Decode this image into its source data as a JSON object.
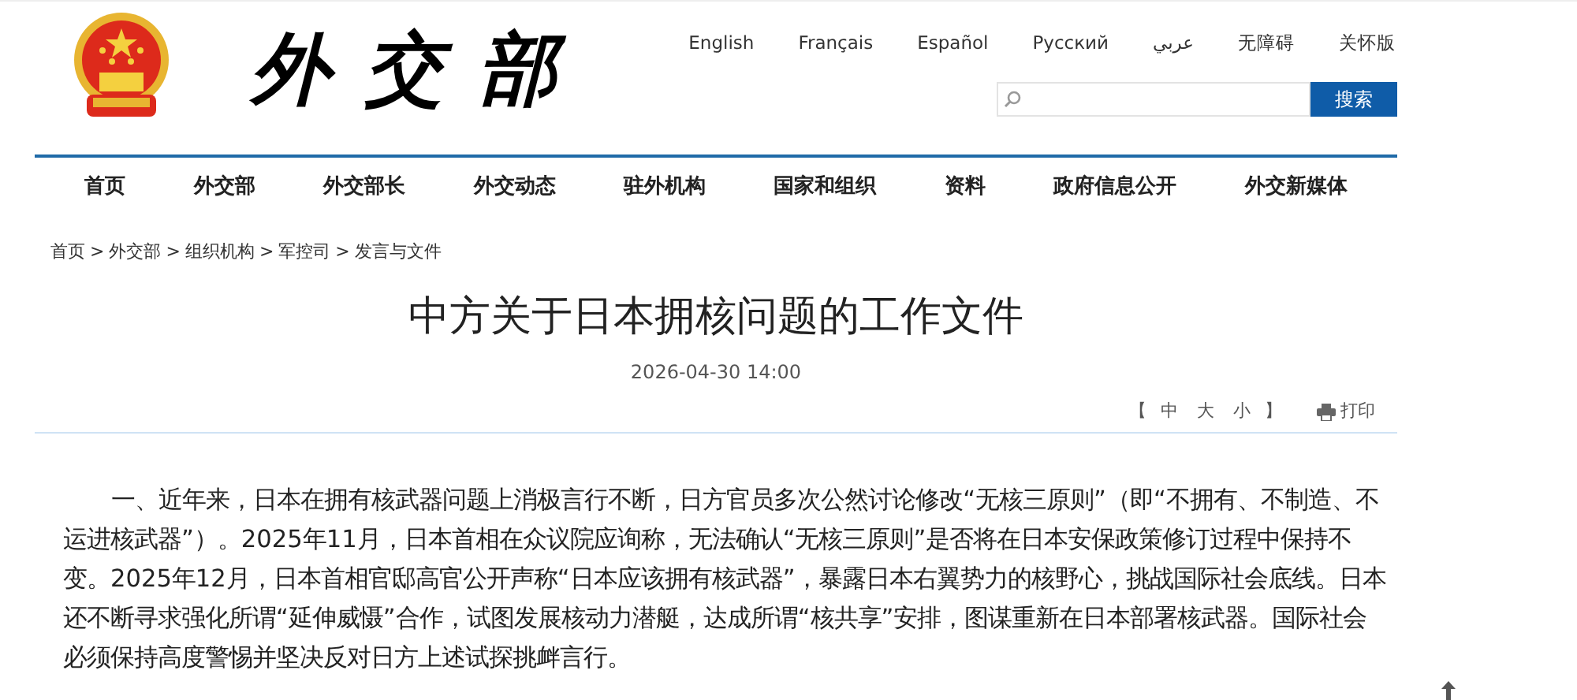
{
  "header": {
    "logo_text": "外交部",
    "languages": [
      "English",
      "Français",
      "Español",
      "Русский",
      "عربي",
      "无障碍",
      "关怀版"
    ],
    "search": {
      "button": "搜索"
    }
  },
  "nav": [
    {
      "label": "首页"
    },
    {
      "label": "外交部"
    },
    {
      "label": "外交部长"
    },
    {
      "label": "外交动态"
    },
    {
      "label": "驻外机构"
    },
    {
      "label": "国家和组织"
    },
    {
      "label": "资料"
    },
    {
      "label": "政府信息公开"
    },
    {
      "label": "外交新媒体"
    }
  ],
  "breadcrumb": [
    "首页",
    "外交部",
    "组织机构",
    "军控司",
    "发言与文件"
  ],
  "breadcrumb_separator": ">",
  "article": {
    "title": "中方关于日本拥核问题的工作文件",
    "date": "2026-04-30 14:00",
    "font_sizes": {
      "open": "【",
      "items": [
        "中",
        "大",
        "小"
      ],
      "close": "】"
    },
    "print": "打印",
    "paragraphs": [
      "一、近年来，日本在拥有核武器问题上消极言行不断，日方官员多次公然讨论修改“无核三原则”（即“不拥有、不制造、不运进核武器”）。2025年11月，日本首相在众议院应询称，无法确认“无核三原则”是否将在日本安保政策修订过程中保持不变。2025年12月，日本首相官邸高官公开声称“日本应该拥有核武器”，暴露日本右翼势力的核野心，挑战国际社会底线。日本还不断寻求强化所谓“延伸威慑”合作，试图发展核动力潜艇，达成所谓“核共享”安排，图谋重新在日本部署核武器。国际社会必须保持高度警惕并坚决反对日方上述试探挑衅言行。"
    ]
  }
}
